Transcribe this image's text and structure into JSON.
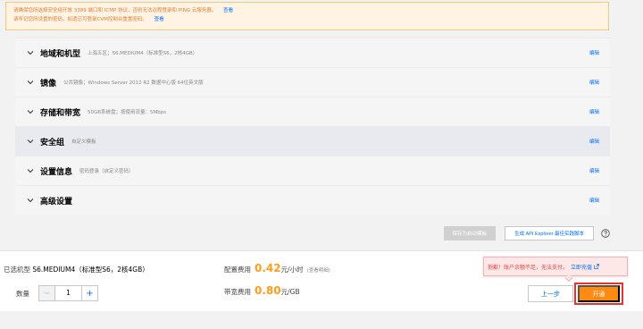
{
  "notice": {
    "line1": "请确保您所选择安全组开放 3389 端口和 ICMP 协议，否则无法远程登录和 PING 云服务器。",
    "line1_link": "查看",
    "line2": "请牢记您所设置的密码，如遗忘可登录CVM控制台重置密码。",
    "line2_link": "查看"
  },
  "sections": [
    {
      "title": "地域和机型",
      "summary": "上海五区；S6.MEDIUM4（标准型S6，2核4GB）",
      "edit": "编辑"
    },
    {
      "title": "镜像",
      "summary": "公共镜像；Windows Server 2012 R2 数据中心版 64位英文版",
      "edit": "编辑"
    },
    {
      "title": "存储和带宽",
      "summary": "50GB系统盘；按使用流量：5Mbps",
      "edit": "编辑"
    },
    {
      "title": "安全组",
      "summary": "自定义模板",
      "edit": "编辑"
    },
    {
      "title": "设置信息",
      "summary": "密码登录（自定义密码）",
      "edit": "编辑"
    },
    {
      "title": "高级设置",
      "summary": "",
      "edit": "编辑"
    }
  ],
  "actions": {
    "save_template": "保存为启动模板",
    "api_explorer": "生成 API Explorer 最佳实践脚本"
  },
  "bottom": {
    "selected_label": "已选机型",
    "selected_value": "S6.MEDIUM4（标准型S6，2核4GB）",
    "quantity_label": "数量",
    "quantity_minus": "−",
    "quantity_value": "1",
    "quantity_plus": "+",
    "config_fee_label": "配置费用",
    "config_fee_amount": "0.42",
    "config_fee_unit": "元/小时",
    "config_fee_note": "(查看明细)",
    "bandwidth_fee_label": "带宽费用",
    "bandwidth_fee_amount": "0.80",
    "bandwidth_fee_unit": "元/GB",
    "prev_button": "上一步",
    "open_button": "开通"
  },
  "tooltip": {
    "message": "抱歉！账户余额不足，无法支付。",
    "recharge_link": "立即充值"
  },
  "colors": {
    "accent": "#006eff",
    "price": "#ff9c19",
    "primary_button": "#ff8a12",
    "error": "#e54545",
    "highlight_outline": "#e3342f"
  },
  "icons": {
    "section_toggle": "chevron-down-icon",
    "help": "question-circle-icon",
    "external": "external-link-icon"
  }
}
